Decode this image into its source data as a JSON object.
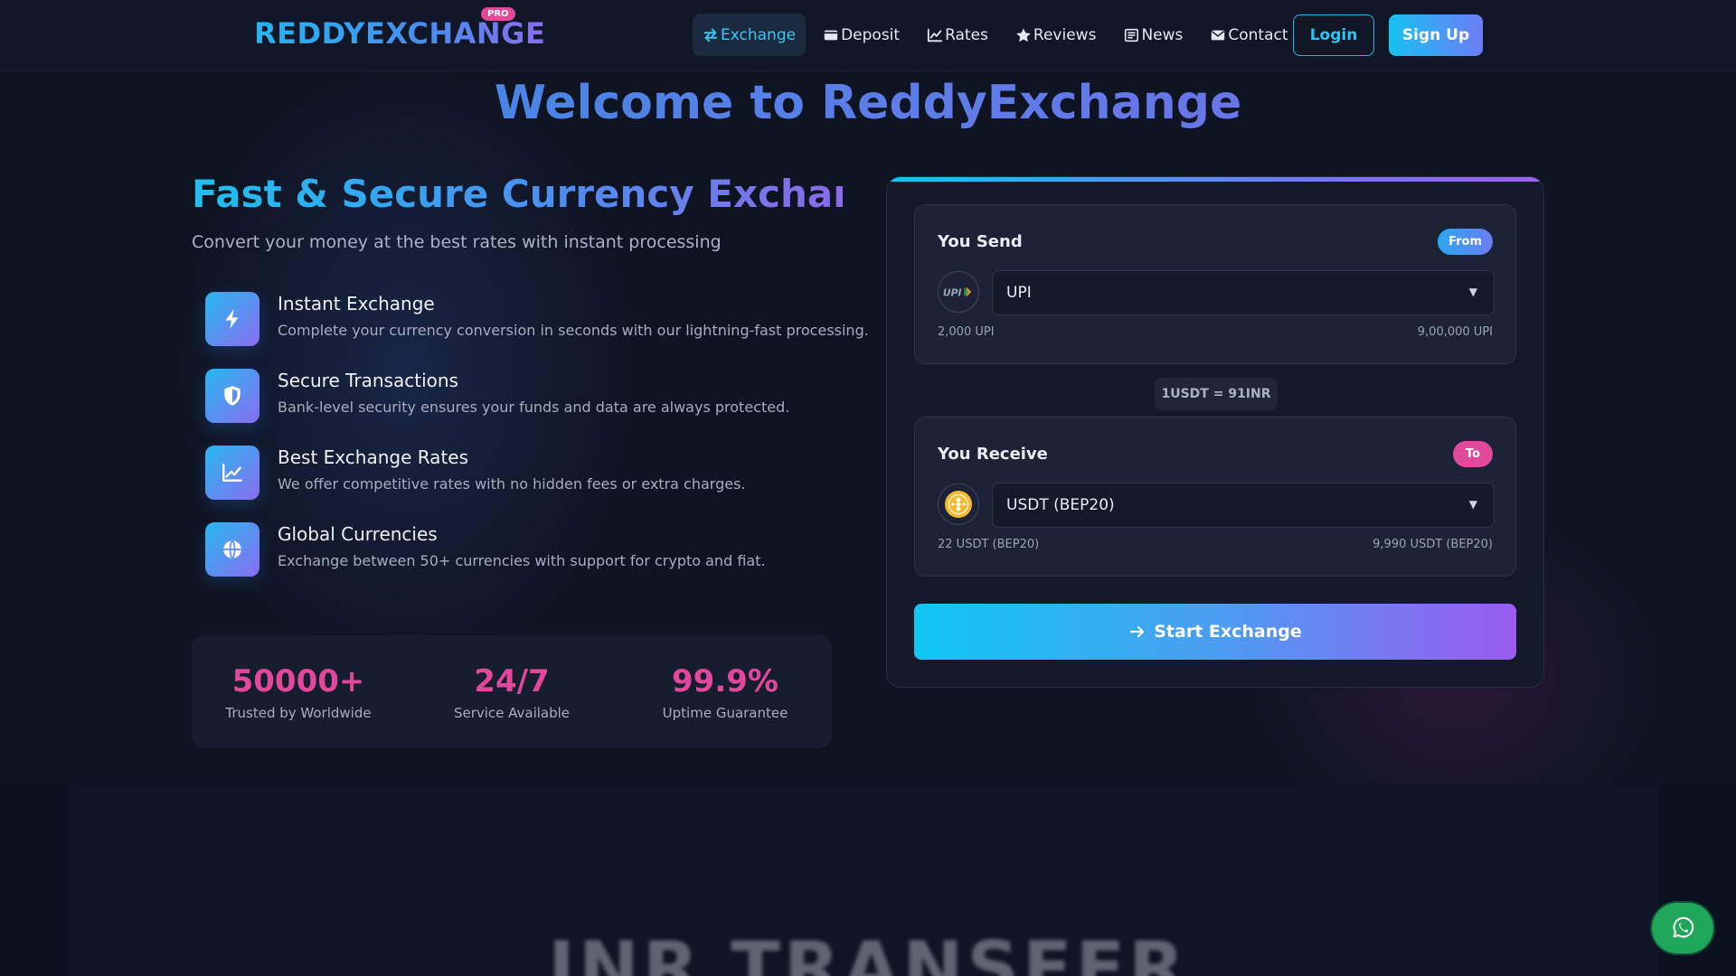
{
  "brand": {
    "name": "REDDYEXCHANGE",
    "badge": "PRO"
  },
  "nav": {
    "links": [
      {
        "label": "Exchange",
        "icon": "exchange-arrows-icon",
        "active": true
      },
      {
        "label": "Deposit",
        "icon": "wallet-icon"
      },
      {
        "label": "Rates",
        "icon": "chart-line-icon"
      },
      {
        "label": "Reviews",
        "icon": "star-icon"
      },
      {
        "label": "News",
        "icon": "newspaper-icon"
      },
      {
        "label": "Contact",
        "icon": "envelope-icon"
      }
    ],
    "login_label": "Login",
    "signup_label": "Sign Up"
  },
  "hero": {
    "welcome": "Welcome to ReddyExchange",
    "title": "Fast & Secure Currency Exchange",
    "subtitle": "Convert your money at the best rates with instant processing",
    "features": [
      {
        "title": "Instant Exchange",
        "desc": "Complete your currency conversion in seconds with our lightning-fast processing.",
        "icon": "bolt-icon"
      },
      {
        "title": "Secure Transactions",
        "desc": "Bank-level security ensures your funds and data are always protected.",
        "icon": "shield-icon"
      },
      {
        "title": "Best Exchange Rates",
        "desc": "We offer competitive rates with no hidden fees or extra charges.",
        "icon": "chart-line-icon"
      },
      {
        "title": "Global Currencies",
        "desc": "Exchange between 50+ currencies with support for crypto and fiat.",
        "icon": "globe-icon"
      }
    ],
    "stats": [
      {
        "value": "50000+",
        "label": "Trusted by Worldwide"
      },
      {
        "value": "24/7",
        "label": "Service Available"
      },
      {
        "value": "99.9%",
        "label": "Uptime Guarantee"
      }
    ]
  },
  "exchange": {
    "send": {
      "title": "You Send",
      "badge": "From",
      "selected": "UPI",
      "coin_icon": "upi-logo-icon",
      "min": "2,000 UPI",
      "max": "9,00,000 UPI"
    },
    "rate": "1USDT = 91INR",
    "receive": {
      "title": "You Receive",
      "badge": "To",
      "selected": "USDT (BEP20)",
      "coin_icon": "bnb-coin-icon",
      "min": "22 USDT (BEP20)",
      "max": "9,990 USDT (BEP20)"
    },
    "start_label": "Start Exchange"
  },
  "lower": {
    "heading": "INR TRANSFER"
  },
  "colors": {
    "accent_cyan": "#1fc0ee",
    "accent_purple": "#8a6cf0",
    "accent_pink": "#e14a9a",
    "whatsapp_green": "#1ea65a",
    "background": "#0f1422"
  }
}
